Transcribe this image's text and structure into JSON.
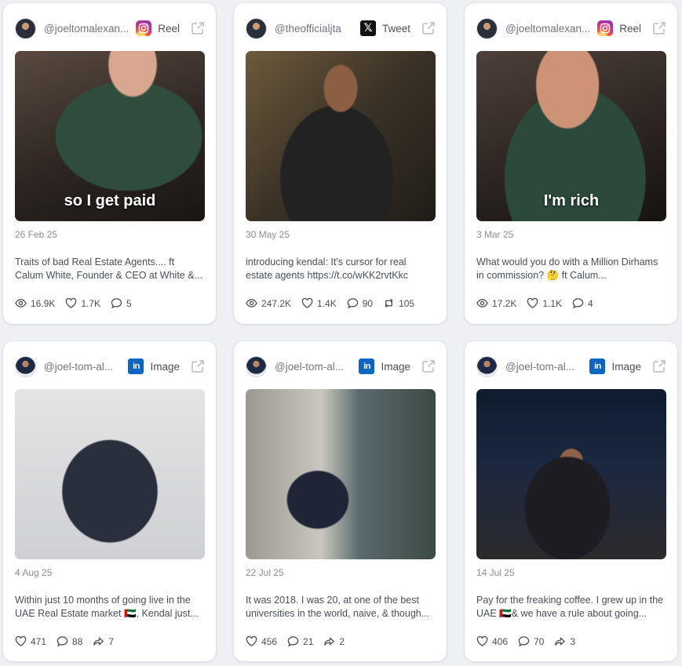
{
  "cards": [
    {
      "handle": "@joeltomalexan...",
      "platform": "Reel",
      "platform_icon": "instagram-icon",
      "caption": "so I get paid",
      "date": "26 Feb 25",
      "text": "Traits of bad Real Estate Agents.... ft Calum White, Founder & CEO at White &...",
      "views": "16.9K",
      "likes": "1.7K",
      "comments": "5"
    },
    {
      "handle": "@theofficialjta",
      "platform": "Tweet",
      "platform_icon": "x-icon",
      "date": "30 May 25",
      "text": "introducing kendal: It's cursor for real estate agents https://t.co/wKK2rvtKkc",
      "views": "247.2K",
      "likes": "1.4K",
      "comments": "90",
      "reposts": "105"
    },
    {
      "handle": "@joeltomalexan...",
      "platform": "Reel",
      "platform_icon": "instagram-icon",
      "caption": "I'm rich",
      "date": "3 Mar 25",
      "text": "What would you do with a Million Dirhams in commission? 🤔 ft Calum...",
      "views": "17.2K",
      "likes": "1.1K",
      "comments": "4"
    },
    {
      "handle": "@joel-tom-al...",
      "platform": "Image",
      "platform_icon": "linkedin-icon",
      "date": "4 Aug 25",
      "text": "Within just 10 months of going live in the UAE Real Estate market 🇦🇪, Kendal just...",
      "likes": "471",
      "comments": "88",
      "shares": "7"
    },
    {
      "handle": "@joel-tom-al...",
      "platform": "Image",
      "platform_icon": "linkedin-icon",
      "date": "22 Jul 25",
      "text": "It was 2018. I was 20, at one of the best universities in the world, naive, & though...",
      "likes": "456",
      "comments": "21",
      "shares": "2"
    },
    {
      "handle": "@joel-tom-al...",
      "platform": "Image",
      "platform_icon": "linkedin-icon",
      "date": "14 Jul 25",
      "text": "Pay for the freaking coffee. I grew up in the UAE 🇦🇪& we have a rule about going...",
      "likes": "406",
      "comments": "70",
      "shares": "3"
    }
  ]
}
